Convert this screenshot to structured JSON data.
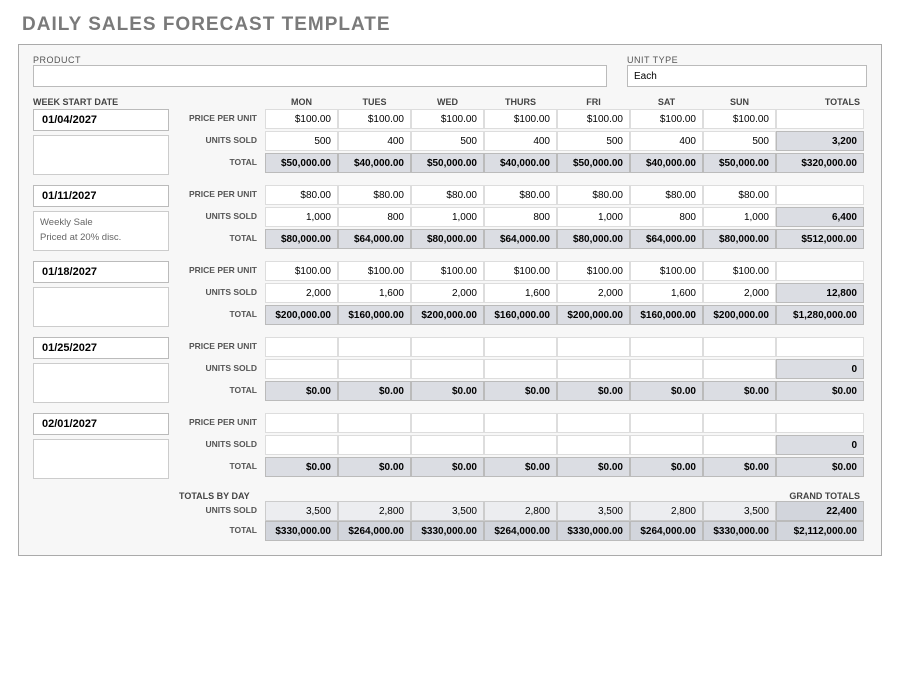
{
  "title": "DAILY SALES FORECAST TEMPLATE",
  "fields": {
    "product_label": "PRODUCT",
    "product_value": "",
    "unit_type_label": "UNIT TYPE",
    "unit_type_value": "Each"
  },
  "headers": {
    "week_start": "WEEK START DATE",
    "days": [
      "MON",
      "TUES",
      "WED",
      "THURS",
      "FRI",
      "SAT",
      "SUN"
    ],
    "totals": "TOTALS"
  },
  "row_labels": {
    "ppu": "PRICE PER UNIT",
    "units": "UNITS SOLD",
    "total": "TOTAL"
  },
  "weeks": [
    {
      "date": "01/04/2027",
      "notes": "",
      "ppu": [
        "$100.00",
        "$100.00",
        "$100.00",
        "$100.00",
        "$100.00",
        "$100.00",
        "$100.00"
      ],
      "units": [
        "500",
        "400",
        "500",
        "400",
        "500",
        "400",
        "500"
      ],
      "units_total": "3,200",
      "totals": [
        "$50,000.00",
        "$40,000.00",
        "$50,000.00",
        "$40,000.00",
        "$50,000.00",
        "$40,000.00",
        "$50,000.00"
      ],
      "week_total": "$320,000.00"
    },
    {
      "date": "01/11/2027",
      "notes": "Weekly Sale\nPriced at 20% disc.",
      "ppu": [
        "$80.00",
        "$80.00",
        "$80.00",
        "$80.00",
        "$80.00",
        "$80.00",
        "$80.00"
      ],
      "units": [
        "1,000",
        "800",
        "1,000",
        "800",
        "1,000",
        "800",
        "1,000"
      ],
      "units_total": "6,400",
      "totals": [
        "$80,000.00",
        "$64,000.00",
        "$80,000.00",
        "$64,000.00",
        "$80,000.00",
        "$64,000.00",
        "$80,000.00"
      ],
      "week_total": "$512,000.00"
    },
    {
      "date": "01/18/2027",
      "notes": "",
      "ppu": [
        "$100.00",
        "$100.00",
        "$100.00",
        "$100.00",
        "$100.00",
        "$100.00",
        "$100.00"
      ],
      "units": [
        "2,000",
        "1,600",
        "2,000",
        "1,600",
        "2,000",
        "1,600",
        "2,000"
      ],
      "units_total": "12,800",
      "totals": [
        "$200,000.00",
        "$160,000.00",
        "$200,000.00",
        "$160,000.00",
        "$200,000.00",
        "$160,000.00",
        "$200,000.00"
      ],
      "week_total": "$1,280,000.00"
    },
    {
      "date": "01/25/2027",
      "notes": "",
      "ppu": [
        "",
        "",
        "",
        "",
        "",
        "",
        ""
      ],
      "units": [
        "",
        "",
        "",
        "",
        "",
        "",
        ""
      ],
      "units_total": "0",
      "totals": [
        "$0.00",
        "$0.00",
        "$0.00",
        "$0.00",
        "$0.00",
        "$0.00",
        "$0.00"
      ],
      "week_total": "$0.00"
    },
    {
      "date": "02/01/2027",
      "notes": "",
      "ppu": [
        "",
        "",
        "",
        "",
        "",
        "",
        ""
      ],
      "units": [
        "",
        "",
        "",
        "",
        "",
        "",
        ""
      ],
      "units_total": "0",
      "totals": [
        "$0.00",
        "$0.00",
        "$0.00",
        "$0.00",
        "$0.00",
        "$0.00",
        "$0.00"
      ],
      "week_total": "$0.00"
    }
  ],
  "grand": {
    "header_left": "TOTALS BY DAY",
    "header_right": "GRAND TOTALS",
    "units_label": "UNITS SOLD",
    "total_label": "TOTAL",
    "units": [
      "3,500",
      "2,800",
      "3,500",
      "2,800",
      "3,500",
      "2,800",
      "3,500"
    ],
    "units_total": "22,400",
    "totals": [
      "$330,000.00",
      "$264,000.00",
      "$330,000.00",
      "$264,000.00",
      "$330,000.00",
      "$264,000.00",
      "$330,000.00"
    ],
    "grand_total": "$2,112,000.00"
  }
}
